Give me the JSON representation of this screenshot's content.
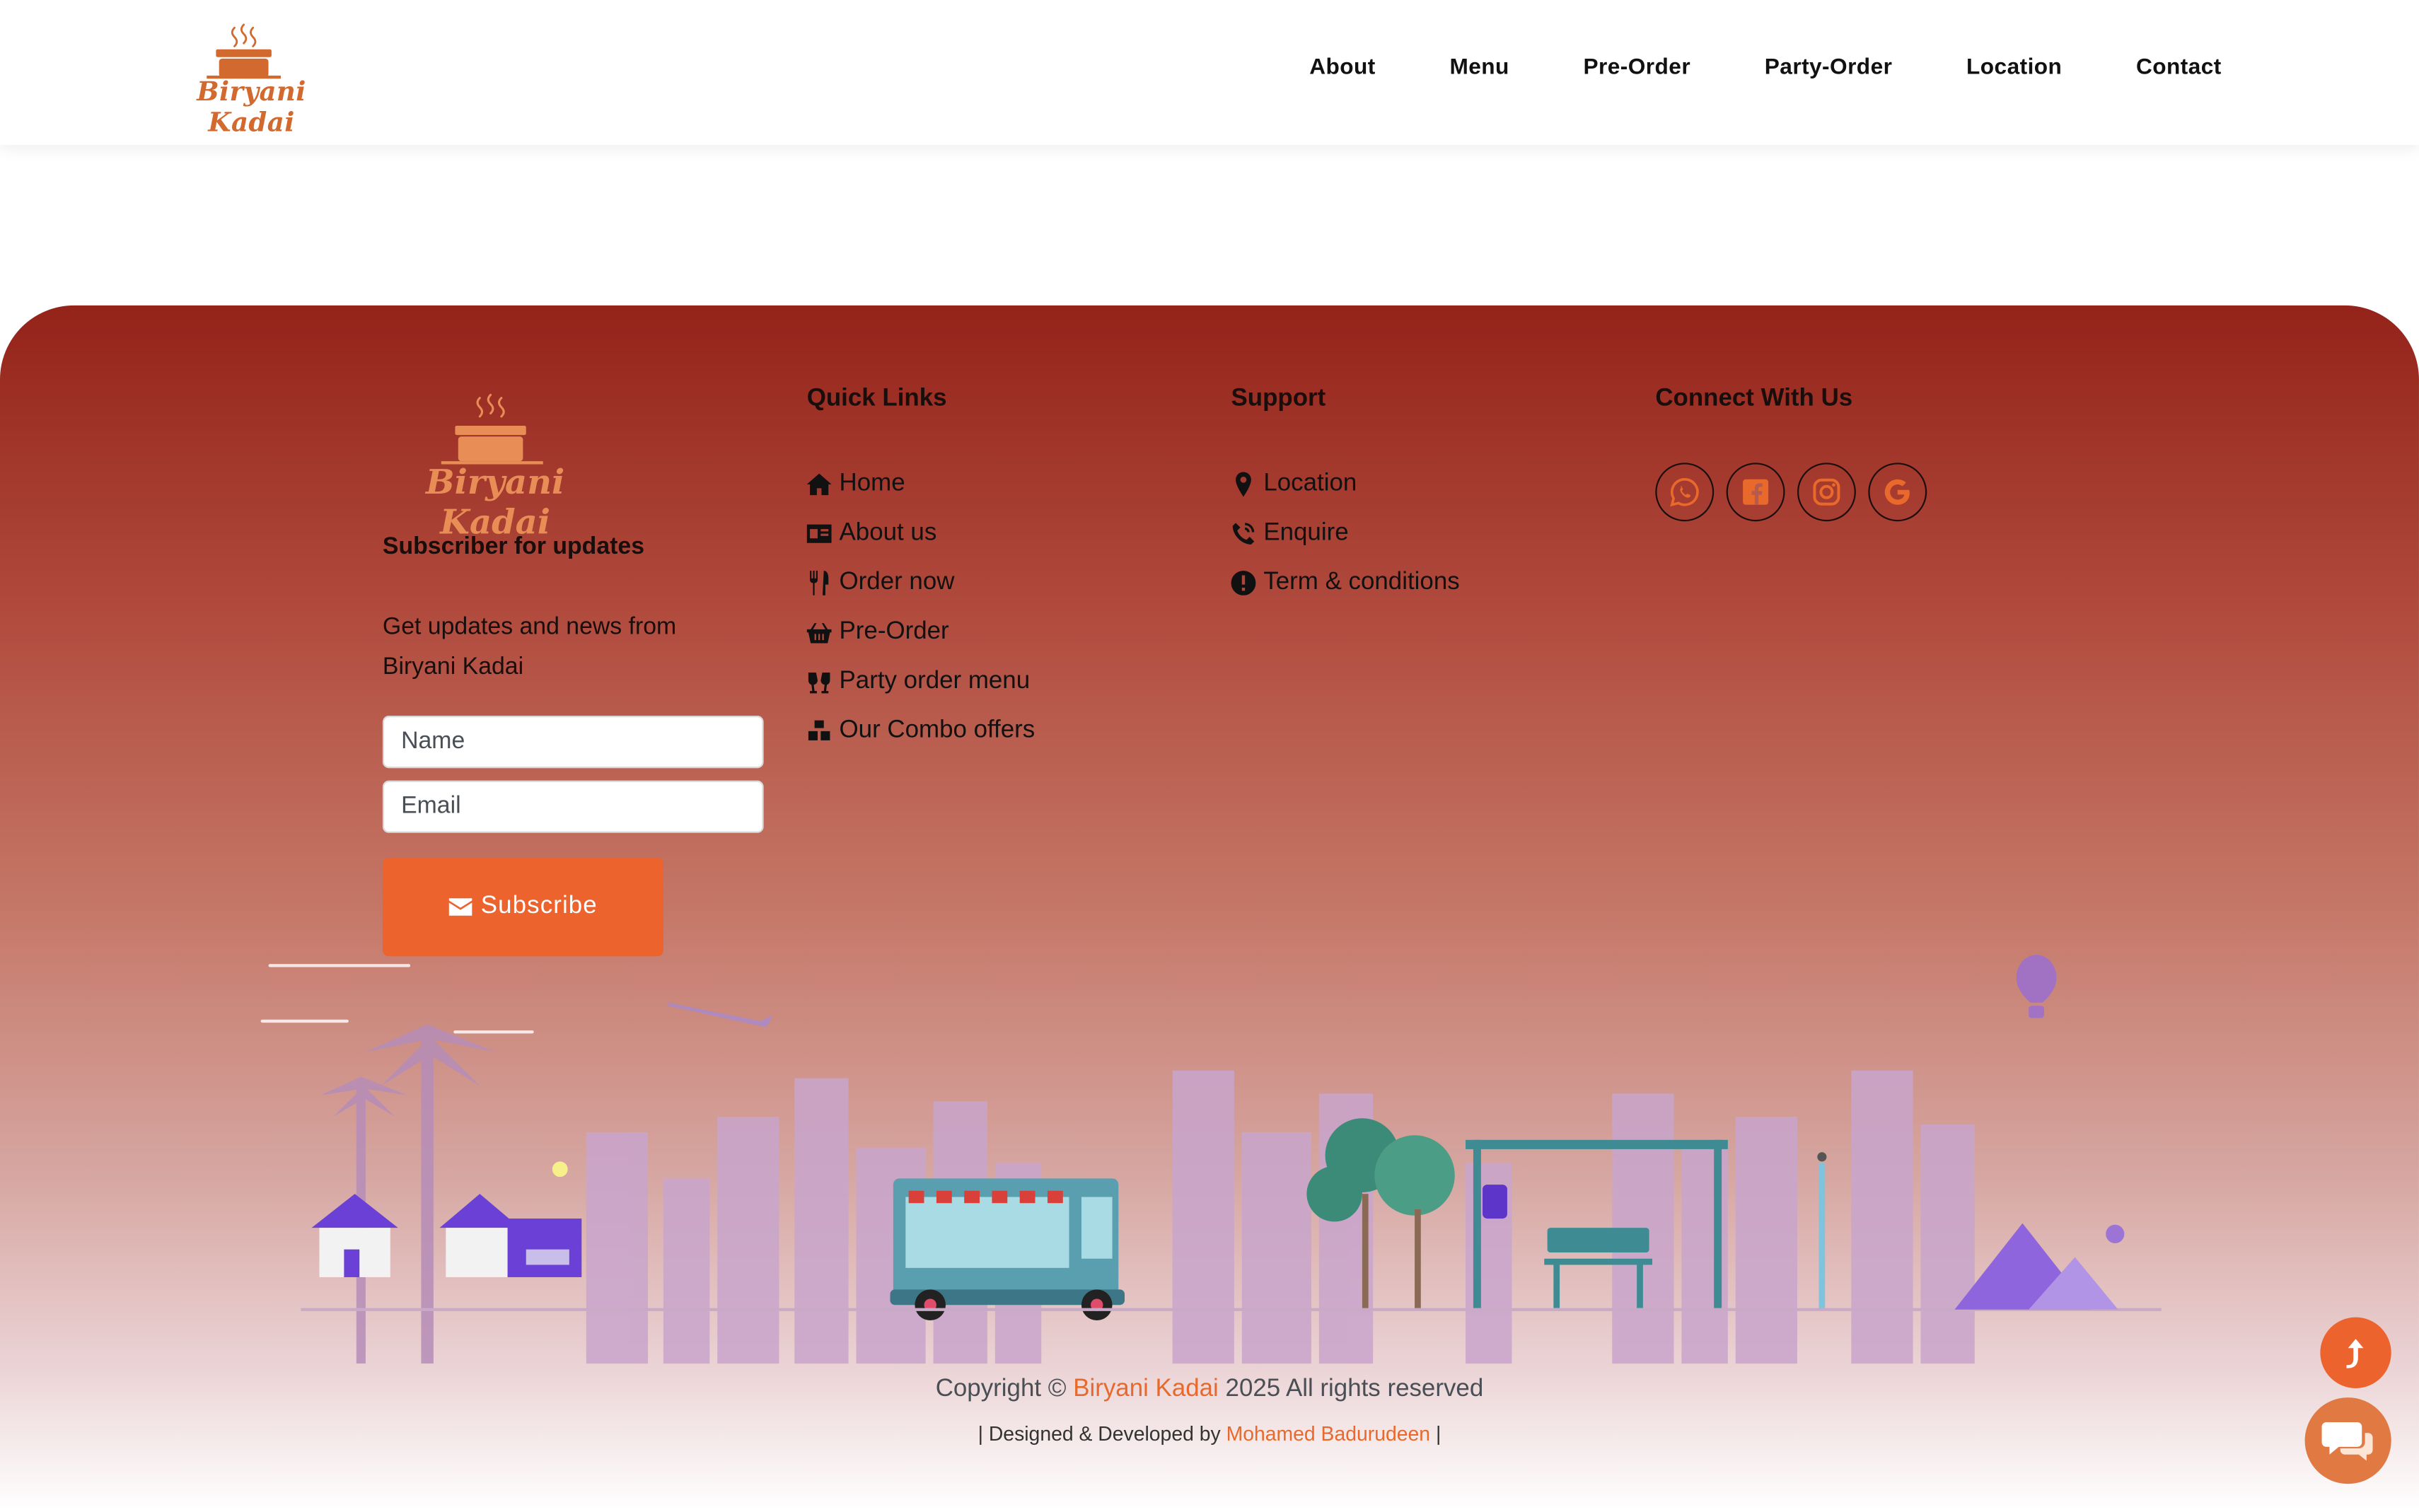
{
  "header": {
    "logo_text": "Biryani Kadai",
    "nav": [
      "About",
      "Menu",
      "Pre-Order",
      "Party-Order",
      "Location",
      "Contact"
    ]
  },
  "footer": {
    "logo_text": "Biryani Kadai",
    "subscribe": {
      "title": "Subscriber for updates",
      "text": "Get updates and news from Biryani Kadai",
      "name_placeholder": "Name",
      "email_placeholder": "Email",
      "button_label": "Subscribe"
    },
    "quick_links": {
      "title": "Quick Links",
      "items": [
        {
          "label": "Home",
          "icon": "home-icon"
        },
        {
          "label": "About us",
          "icon": "id-card-icon"
        },
        {
          "label": "Order now",
          "icon": "utensils-icon"
        },
        {
          "label": "Pre-Order",
          "icon": "basket-icon"
        },
        {
          "label": "Party order menu",
          "icon": "cheers-icon"
        },
        {
          "label": "Our Combo offers",
          "icon": "cubes-icon"
        }
      ]
    },
    "support": {
      "title": "Support",
      "items": [
        {
          "label": "Location",
          "icon": "map-pin-icon"
        },
        {
          "label": "Enquire",
          "icon": "phone-icon"
        },
        {
          "label": "Term & conditions",
          "icon": "exclamation-circle-icon"
        }
      ]
    },
    "connect": {
      "title": "Connect With Us",
      "socials": [
        "whatsapp-icon",
        "facebook-icon",
        "instagram-icon",
        "google-icon"
      ]
    },
    "copyright": {
      "prefix": "Copyright ©",
      "brand": "Biryani Kadai",
      "suffix": "2025 All rights reserved"
    },
    "designed": {
      "prefix": "| Designed & Developed by",
      "author": "Mohamed Badurudeen",
      "suffix": "|"
    }
  },
  "colors": {
    "accent": "#ec632e",
    "brand_orange": "#d2692f",
    "footer_top": "#94231a"
  }
}
